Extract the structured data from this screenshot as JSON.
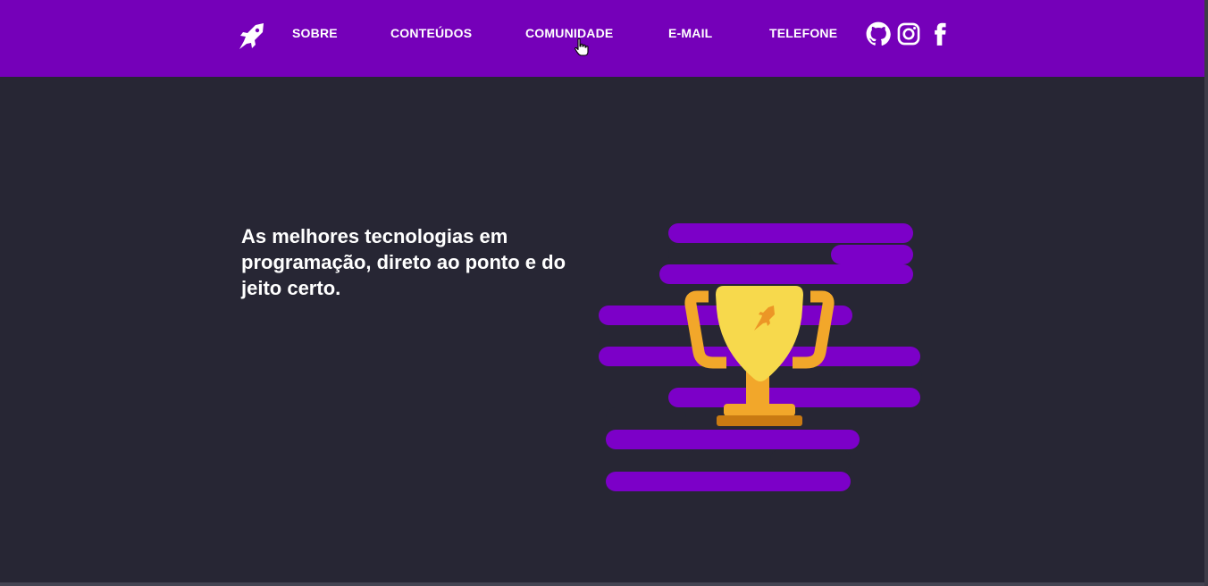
{
  "header": {
    "background_color": "#7500b9",
    "logo": "rocket-logo-icon",
    "nav": [
      {
        "label": "SOBRE"
      },
      {
        "label": "CONTEÚDOS"
      },
      {
        "label": "COMUNIDADE"
      },
      {
        "label": "E-MAIL"
      },
      {
        "label": "TELEFONE"
      }
    ],
    "social": [
      "github-icon",
      "instagram-icon",
      "facebook-icon"
    ]
  },
  "hero": {
    "text_line1": "As melhores tecnologias em",
    "text_line2": "programação, direto ao ponto e do",
    "text_line3": "jeito certo.",
    "illustration": "trophy-icon",
    "accent_color": "#7c00c8",
    "trophy_color": "#f7d94c"
  },
  "page": {
    "background_color": "#272634"
  }
}
